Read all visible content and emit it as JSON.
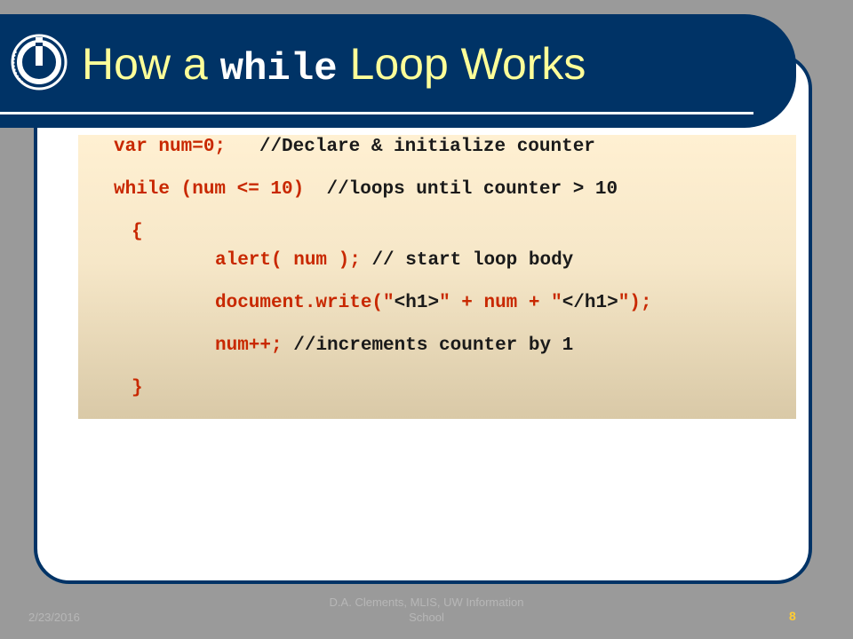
{
  "slide": {
    "title_prefix": "How a ",
    "title_keyword": "while",
    "title_suffix": " Loop Works"
  },
  "code": {
    "line1_code": "var num=0;",
    "line1_comment": "//Declare & initialize counter",
    "line2_code": "while (num <= 10)",
    "line2_comment": "//loops until counter > 10",
    "line3_brace": "{",
    "line4_code": "alert( num );",
    "line4_comment": "// start loop body",
    "line5_a": "document.write(\"",
    "line5_b": "<h1>",
    "line5_c": "\" + num + \"",
    "line5_d": "</h1>",
    "line5_e": "\");",
    "line6_code": "num++;",
    "line6_comment": "//increments counter by 1",
    "line7_brace": "}"
  },
  "footer": {
    "date": "2/23/2016",
    "author_line1": "D.A. Clements, MLIS, UW Information",
    "author_line2": "School",
    "page_number": "8"
  },
  "colors": {
    "title_bar": "#003366",
    "title_text": "#ffff99",
    "code_red": "#c82800",
    "code_dark": "#1a1a1a"
  },
  "icons": {
    "logo": "information-school-logo-icon"
  }
}
